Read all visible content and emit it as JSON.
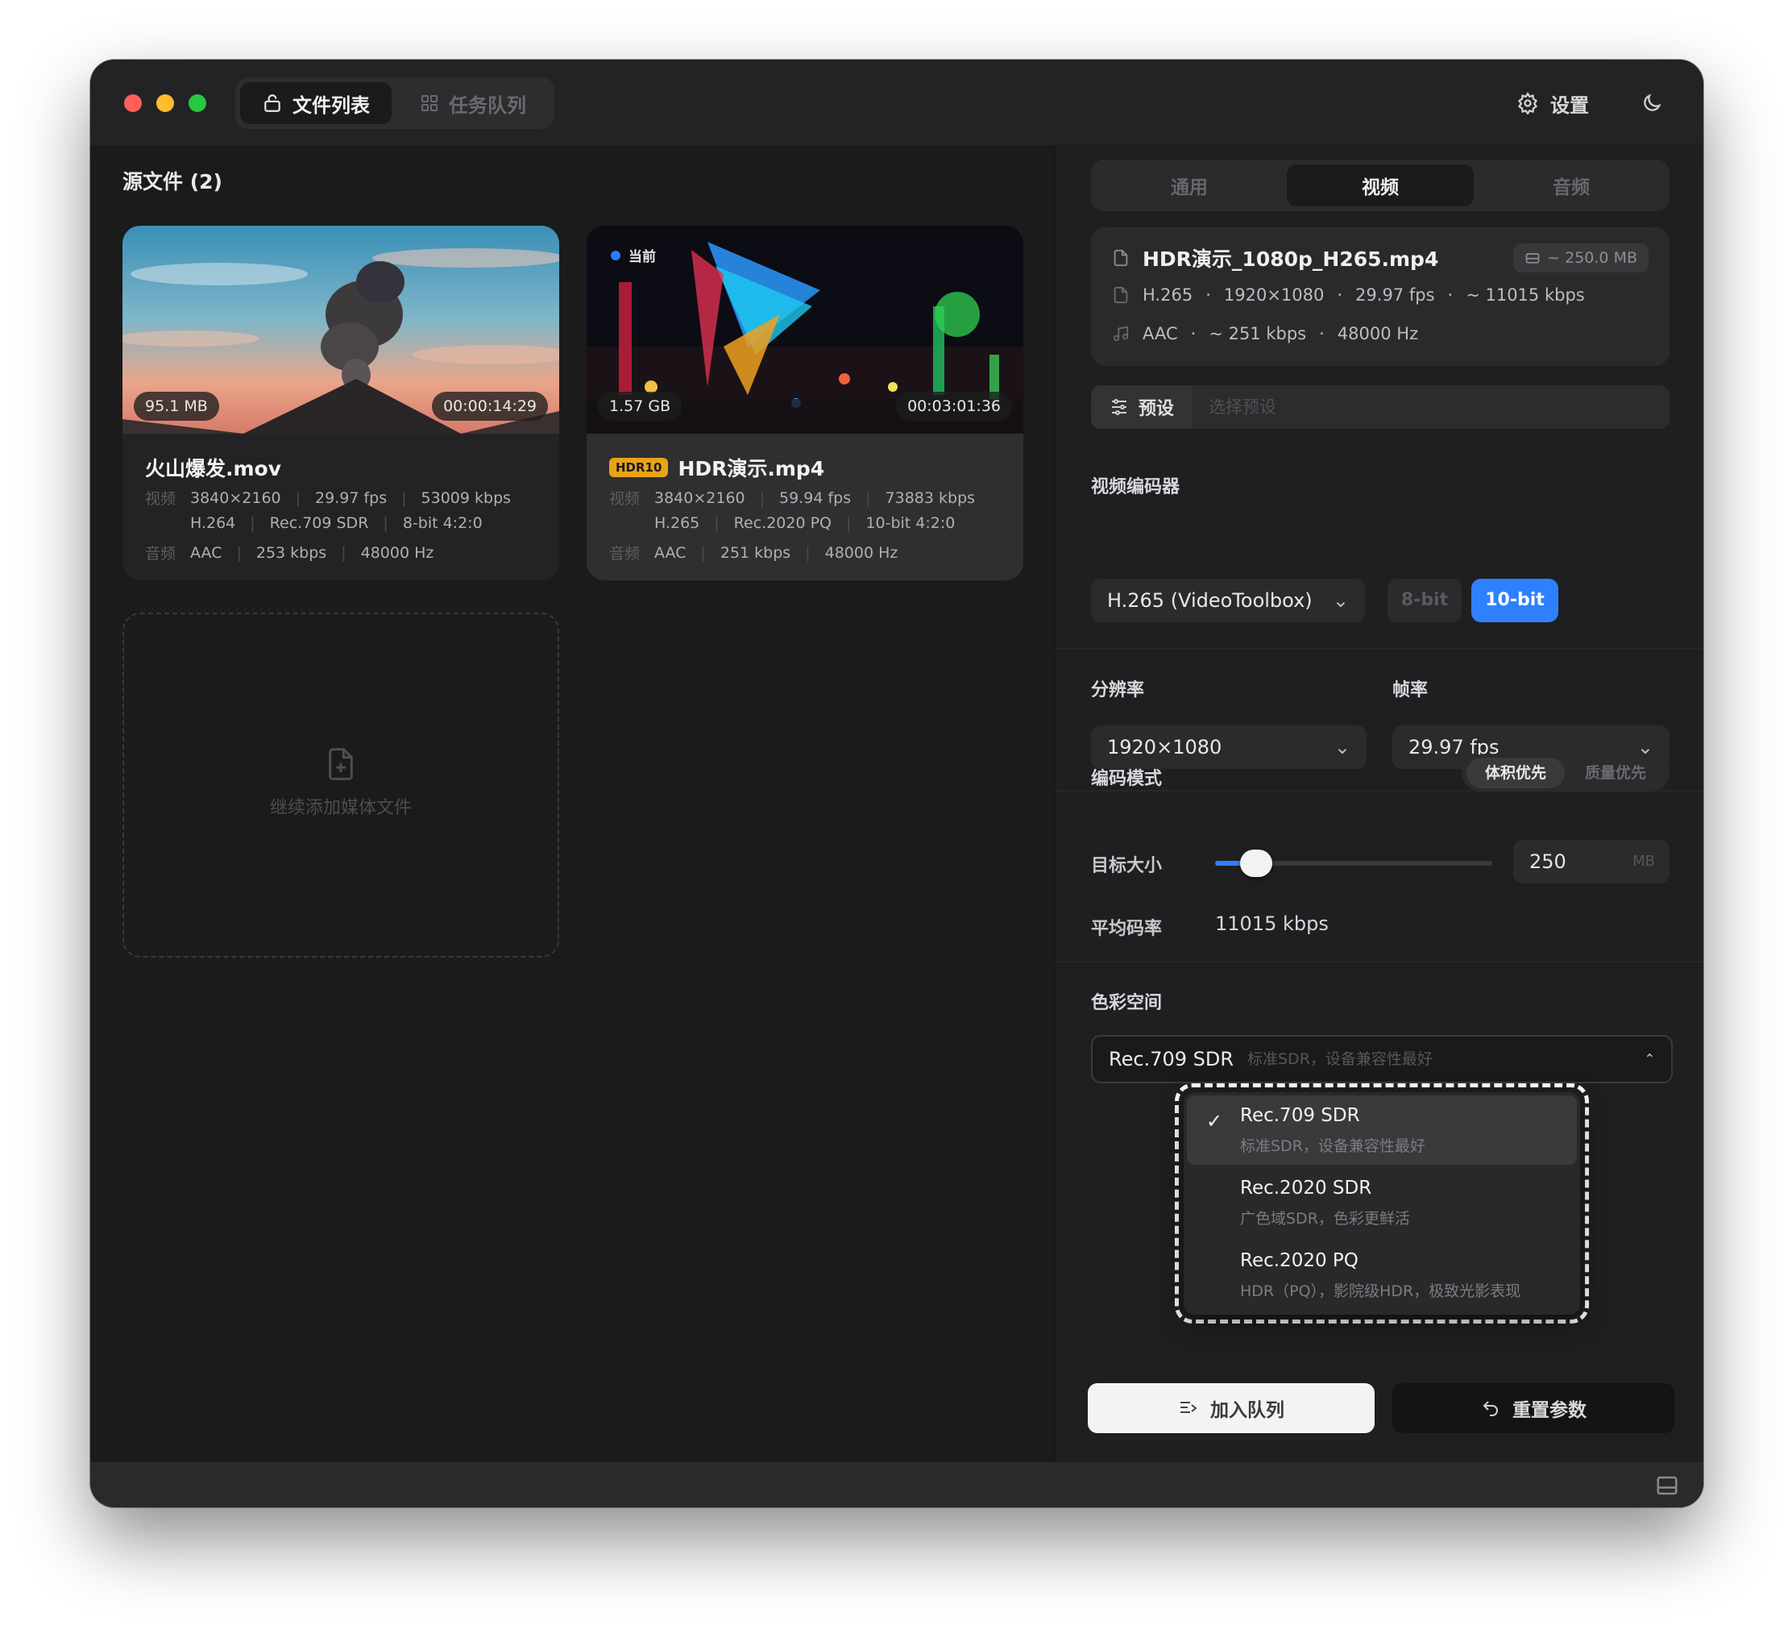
{
  "titlebar": {
    "tab_files": "文件列表",
    "tab_queue": "任务队列",
    "settings_label": "设置"
  },
  "sources": {
    "title": "源文件 (2)",
    "files": [
      {
        "name": "火山爆发.mov",
        "size": "95.1 MB",
        "duration": "00:00:14:29",
        "video_label": "视频",
        "resolution": "3840×2160",
        "fps": "29.97 fps",
        "bitrate": "53009 kbps",
        "codec": "H.264",
        "color": "Rec.709 SDR",
        "depth": "8-bit 4:2:0",
        "audio_label": "音频",
        "audio_codec": "AAC",
        "audio_bitrate": "253 kbps",
        "audio_rate": "48000 Hz"
      },
      {
        "name": "HDR演示.mp4",
        "tag": "HDR10",
        "current": "当前",
        "size": "1.57 GB",
        "duration": "00:03:01:36",
        "video_label": "视频",
        "resolution": "3840×2160",
        "fps": "59.94 fps",
        "bitrate": "73883 kbps",
        "codec": "H.265",
        "color": "Rec.2020 PQ",
        "depth": "10-bit 4:2:0",
        "audio_label": "音频",
        "audio_codec": "AAC",
        "audio_bitrate": "251 kbps",
        "audio_rate": "48000 Hz"
      }
    ],
    "add_more": "继续添加媒体文件"
  },
  "panel": {
    "tabs": [
      "通用",
      "视频",
      "音频"
    ],
    "active_tab": "视频",
    "output": {
      "filename": "HDR演示_1080p_H265.mp4",
      "size_estimate": "~ 250.0 MB",
      "video_codec": "H.265",
      "resolution": "1920×1080",
      "fps": "29.97 fps",
      "bitrate": "~ 11015 kbps",
      "audio_codec": "AAC",
      "audio_bitrate": "~ 251 kbps",
      "audio_rate": "48000 Hz"
    },
    "preset_label": "预设",
    "preset_placeholder": "选择预设",
    "encoder_title": "视频编码器",
    "encoder_value": "H.265 (VideoToolbox)",
    "bit_8": "8-bit",
    "bit_10": "10-bit",
    "selected_bit": "10-bit",
    "resolution_title": "分辨率",
    "resolution_value": "1920×1080",
    "fps_title": "帧率",
    "fps_value": "29.97 fps",
    "mode_title": "编码模式",
    "mode_size": "体积优先",
    "mode_quality": "质量优先",
    "target_label": "目标大小",
    "target_value": "250",
    "target_unit": "MB",
    "target_slider_fraction": 0.09,
    "avg_label": "平均码率",
    "avg_value": "11015 kbps",
    "colorspace_title": "色彩空间",
    "colorspace_value": "Rec.709 SDR",
    "colorspace_desc": "标准SDR，设备兼容性最好",
    "colorspace_options": [
      {
        "title": "Rec.709 SDR",
        "desc": "标准SDR，设备兼容性最好",
        "selected": true
      },
      {
        "title": "Rec.2020 SDR",
        "desc": "广色域SDR，色彩更鲜活",
        "selected": false
      },
      {
        "title": "Rec.2020 PQ",
        "desc": "HDR（PQ），影院级HDR，极致光影表现",
        "selected": false
      }
    ],
    "add_queue": "加入队列",
    "reset": "重置参数"
  },
  "colors": {
    "accent": "#2f80ff",
    "hdr_tag": "#e8a317",
    "window_bg": "#1c1c1d"
  }
}
